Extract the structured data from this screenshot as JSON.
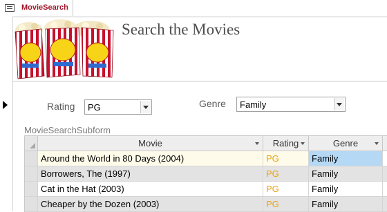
{
  "tab": {
    "label": "MovieSearch",
    "icon": "form-icon"
  },
  "header": {
    "title": "Search the Movies",
    "logo": "popcorn-box-image"
  },
  "filters": {
    "rating": {
      "label": "Rating",
      "value": "PG"
    },
    "genre": {
      "label": "Genre",
      "value": "Family"
    }
  },
  "subform": {
    "label": "MovieSearchSubform",
    "columns": [
      "Movie",
      "Rating",
      "Genre"
    ],
    "rows": [
      {
        "movie": "Around the World in 80 Days (2004)",
        "rating": "PG",
        "genre": "Family"
      },
      {
        "movie": "Borrowers, The (1997)",
        "rating": "PG",
        "genre": "Family"
      },
      {
        "movie": "Cat in the Hat (2003)",
        "rating": "PG",
        "genre": "Family"
      },
      {
        "movie": "Cheaper by the Dozen (2003)",
        "rating": "PG",
        "genre": "Family"
      }
    ]
  },
  "colors": {
    "tab_label": "#a2162a",
    "rating_text": "#e8a317",
    "selected_cell": "#b5d9f5"
  }
}
